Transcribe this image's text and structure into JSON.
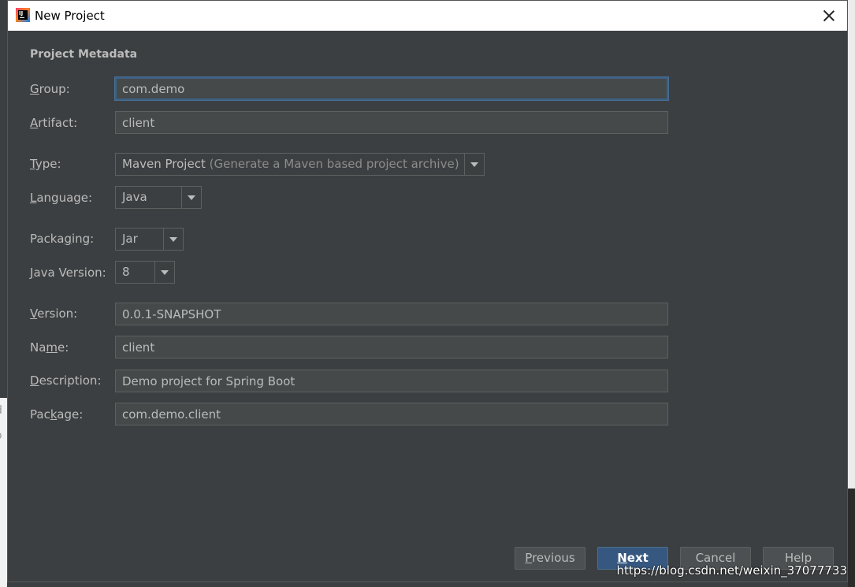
{
  "window": {
    "title": "New Project",
    "icon": "intellij-idea-icon"
  },
  "section": {
    "title": "Project Metadata"
  },
  "form": {
    "group": {
      "label_mnemonic": "G",
      "label_rest": "roup:",
      "value": "com.demo"
    },
    "artifact": {
      "label_mnemonic": "A",
      "label_rest": "rtifact:",
      "value": "client"
    },
    "type": {
      "label_mnemonic": "T",
      "label_rest": "ype:",
      "value": "Maven Project",
      "hint": "(Generate a Maven based project archive)"
    },
    "language": {
      "label_mnemonic": "L",
      "label_rest": "anguage:",
      "value": "Java"
    },
    "packaging": {
      "label_pre": "Packa",
      "label_mnemonic": "g",
      "label_rest": "ing:",
      "value": "Jar"
    },
    "java_version": {
      "label_mnemonic": "J",
      "label_rest": "ava Version:",
      "value": "8"
    },
    "version": {
      "label_mnemonic": "V",
      "label_rest": "ersion:",
      "value": "0.0.1-SNAPSHOT"
    },
    "name": {
      "label_pre": "Na",
      "label_mnemonic": "m",
      "label_rest": "e:",
      "value": "client"
    },
    "description": {
      "label_mnemonic": "D",
      "label_rest": "escription:",
      "value": "Demo project for Spring Boot"
    },
    "package": {
      "label_pre": "Pac",
      "label_mnemonic": "k",
      "label_rest": "age:",
      "value": "com.demo.client"
    }
  },
  "buttons": {
    "previous": {
      "mnemonic": "P",
      "rest": "revious"
    },
    "next": {
      "mnemonic": "N",
      "rest": "ext"
    },
    "cancel": "Cancel",
    "help": "Help"
  },
  "watermark": "https://blog.csdn.net/weixin_37077733",
  "background": {
    "glyph_1": "d",
    "glyph_2": "o"
  },
  "colors": {
    "dialog_bg": "#3c3f41",
    "field_bg": "#45494a",
    "focus_border": "#3d6185",
    "primary_button": "#365880",
    "text": "#bbbbbb"
  }
}
